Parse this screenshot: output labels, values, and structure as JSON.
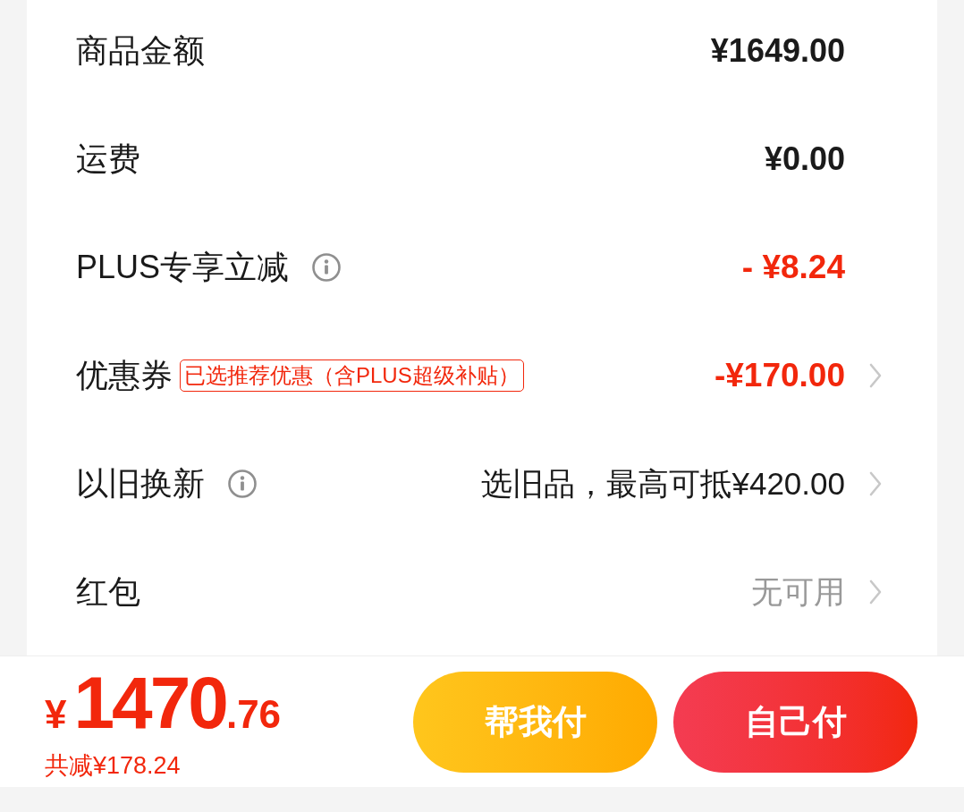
{
  "fee_rows": [
    {
      "kind": "amount",
      "label": "商品金额",
      "info": false,
      "value": "¥1649.00",
      "chevron": false
    },
    {
      "kind": "amount",
      "label": "运费",
      "info": false,
      "value": "¥0.00",
      "chevron": false
    },
    {
      "kind": "discount",
      "label": "PLUS专享立减",
      "info": true,
      "value": "- ¥8.24",
      "chevron": false
    },
    {
      "kind": "discount",
      "label": "优惠券",
      "info": false,
      "tag": "已选推荐优惠（含PLUS超级补贴）",
      "value": "-¥170.00",
      "chevron": true
    },
    {
      "kind": "option",
      "label": "以旧换新",
      "info": true,
      "value": "选旧品，最高可抵¥420.00",
      "chevron": true
    },
    {
      "kind": "muted",
      "label": "红包",
      "info": false,
      "value": "无可用",
      "chevron": true
    }
  ],
  "checkout_bar": {
    "currency": "¥",
    "amount_integer": "1470",
    "amount_decimal": ".76",
    "savings": "共减¥178.24",
    "buttons": [
      {
        "label": "帮我付",
        "kind": "secondary"
      },
      {
        "label": "自己付",
        "kind": "primary"
      }
    ]
  }
}
